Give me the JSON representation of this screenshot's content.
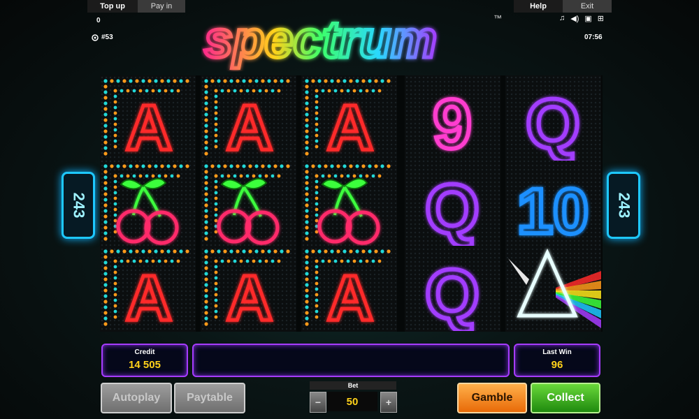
{
  "topbar": {
    "topup_label": "Top up",
    "payin_label": "Pay in",
    "help_label": "Help",
    "exit_label": "Exit",
    "balance": "0",
    "ticket": "#53",
    "clock": "07:56",
    "icons": [
      "music-note-icon",
      "speaker-icon",
      "settings-icon",
      "fullscreen-icon"
    ]
  },
  "game": {
    "title": "spectrum",
    "trademark": "™",
    "ways_left": "243",
    "ways_right": "243",
    "reels": [
      [
        "A",
        "cherry",
        "A"
      ],
      [
        "A",
        "cherry",
        "A"
      ],
      [
        "A",
        "cherry",
        "A"
      ],
      [
        "9",
        "Q",
        "Q"
      ],
      [
        "Q",
        "10",
        "prism"
      ]
    ]
  },
  "panels": {
    "credit_label": "Credit",
    "credit_value": "14 505",
    "message": "",
    "lastwin_label": "Last Win",
    "lastwin_value": "96"
  },
  "controls": {
    "autoplay_label": "Autoplay",
    "paytable_label": "Paytable",
    "bet_label": "Bet",
    "bet_value": "50",
    "bet_minus": "−",
    "bet_plus": "+",
    "gamble_label": "Gamble",
    "collect_label": "Collect"
  },
  "colors": {
    "ace": "#ff2a2a",
    "cherry": "#ff2a6a",
    "leaf": "#3cff3c",
    "dots_a": "#22d8d8",
    "dots_b": "#ff9a1a",
    "nine": "#ff3ccf",
    "queen": "#a23cff",
    "ten": "#1e90ff",
    "accent": "#a63cff",
    "value": "#ffd21a"
  }
}
